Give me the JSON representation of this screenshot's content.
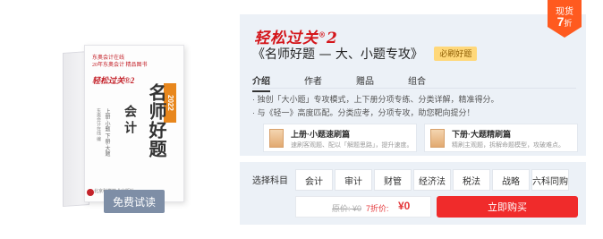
{
  "book": {
    "brand": "轻松过关®2",
    "logo_text": "东奥会计在线",
    "logo_sub": "20年东奥会计 精品图书",
    "title": "名师好题",
    "year": "2022",
    "subject": "会计",
    "sub2": "上册·小题 下册·大题",
    "sub3": "东奥会计在线 编",
    "publisher": "北京科学技术出版社"
  },
  "trial_button": "免费试读",
  "badge": {
    "line1": "现货",
    "line2": "7",
    "line2_unit": "折"
  },
  "info": {
    "brand": "轻松过关",
    "brand_num": "2",
    "brand_sup": "®",
    "title": "《名师好题 — 大、小题专攻》",
    "tag": "必刷好题",
    "tabs": [
      "介绍",
      "作者",
      "赠品",
      "组合"
    ],
    "desc": [
      "· 独创「大小题」专攻模式，上下册分项专练、分类详解，精准得分。",
      "· 与《轻一》高度匹配。分类应考，分项专攻，助您靶向提分！"
    ],
    "cards": [
      {
        "title": "上册·小题速刷篇",
        "sub": "速刷客观题、配以「解题思路」，提升速度。"
      },
      {
        "title": "下册·大题精刷篇",
        "sub": "精刷主观题，拆解命题模型，攻破难点。"
      }
    ]
  },
  "buy": {
    "subject_label": "选择科目",
    "subjects": [
      "会计",
      "审计",
      "财管",
      "经济法",
      "税法",
      "战略",
      "六科同购"
    ],
    "orig_price": "原价: ¥0",
    "discount": "7折价:",
    "final_price": "¥0",
    "buy_button": "立即购买"
  },
  "colors": {
    "accent": "#f02b2b",
    "badge": "#ff5a1f",
    "tag": "#ffd87a",
    "panel": "#ecf1f7",
    "trial": "#7e8ea6"
  }
}
